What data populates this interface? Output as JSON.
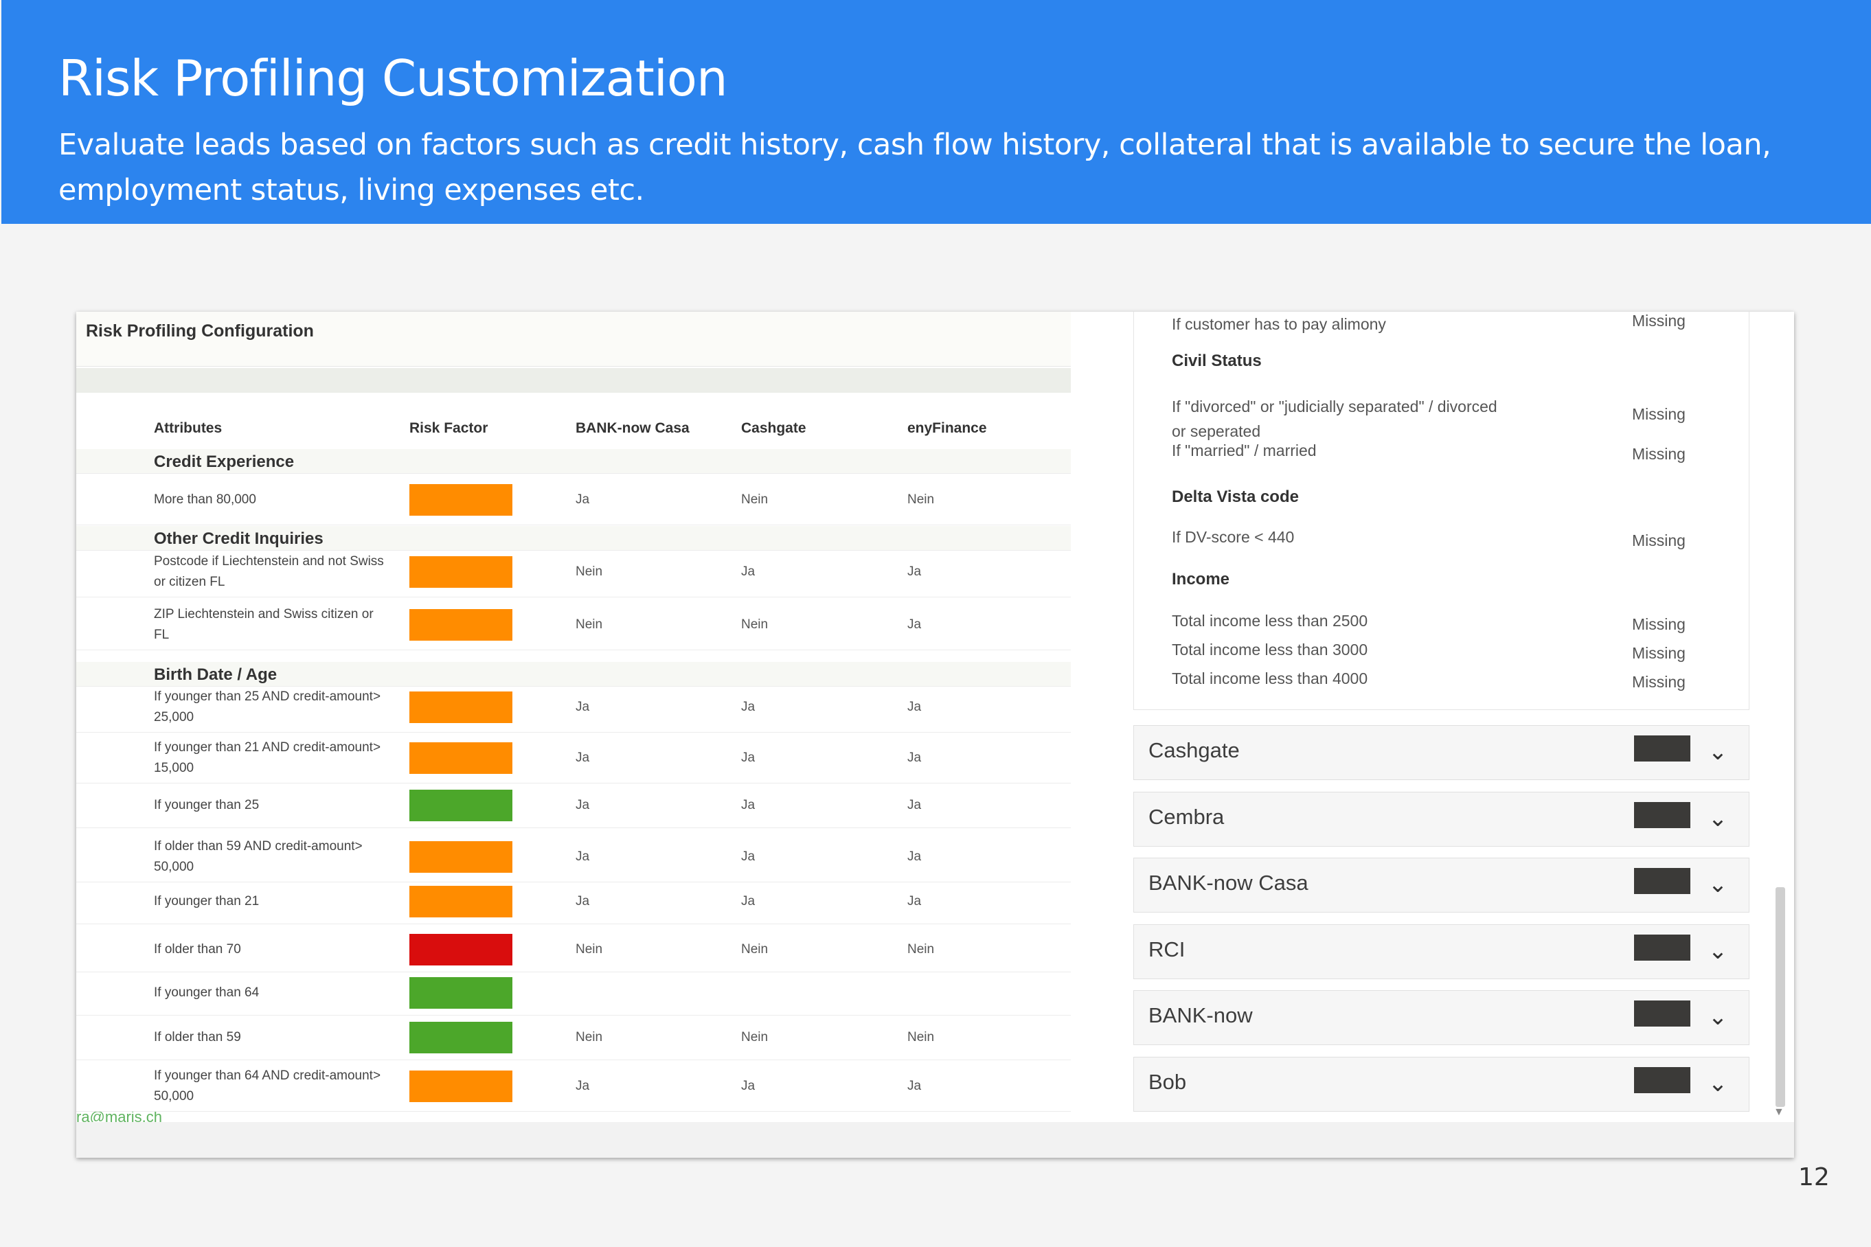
{
  "slide": {
    "title": "Risk Profiling Customization",
    "subtitle": "Evaluate leads based on factors such as credit history, cash flow history, collateral that is available to secure the loan, employment status, living expenses etc.",
    "page_number": "12"
  },
  "config": {
    "title": "Risk Profiling Configuration",
    "headers": [
      "Attributes",
      "Risk Factor",
      "BANK-now Casa",
      "Cashgate",
      "enyFinance"
    ],
    "footer_link": "ra@maris.ch",
    "sections": [
      {
        "label": "Credit Experience",
        "rows": [
          {
            "attr": "More than 80,000",
            "risk": "#ff8c00",
            "vals": [
              "Ja",
              "Nein",
              "Nein"
            ]
          }
        ]
      },
      {
        "label": "Other Credit Inquiries",
        "rows": [
          {
            "attr": "Postcode if Liechtenstein and not Swiss or citizen FL",
            "risk": "#ff8c00",
            "vals": [
              "Nein",
              "Ja",
              "Ja"
            ]
          },
          {
            "attr": "ZIP Liechtenstein and Swiss citizen or FL",
            "risk": "#ff8c00",
            "vals": [
              "Nein",
              "Nein",
              "Ja"
            ]
          }
        ]
      },
      {
        "label": "Birth Date / Age",
        "rows": [
          {
            "attr": "If younger than 25 AND credit-amount> 25,000",
            "risk": "#ff8c00",
            "vals": [
              "Ja",
              "Ja",
              "Ja"
            ]
          },
          {
            "attr": "If younger than 21 AND credit-amount> 15,000",
            "risk": "#ff8c00",
            "vals": [
              "Ja",
              "Ja",
              "Ja"
            ]
          },
          {
            "attr": "If younger than 25",
            "risk": "#4ca72a",
            "vals": [
              "Ja",
              "Ja",
              "Ja"
            ]
          },
          {
            "attr": "If older than 59 AND credit-amount> 50,000",
            "risk": "#ff8c00",
            "vals": [
              "Ja",
              "Ja",
              "Ja"
            ]
          },
          {
            "attr": "If younger than 21",
            "risk": "#ff8c00",
            "vals": [
              "Ja",
              "Ja",
              "Ja"
            ]
          },
          {
            "attr": "If older than 70",
            "risk": "#d90d0d",
            "vals": [
              "Nein",
              "Nein",
              "Nein"
            ]
          },
          {
            "attr": "If younger than 64",
            "risk": "#4ca72a",
            "vals": [
              "",
              "",
              ""
            ]
          },
          {
            "attr": "If older than 59",
            "risk": "#4ca72a",
            "vals": [
              "Nein",
              "Nein",
              "Nein"
            ]
          },
          {
            "attr": "If younger than 64 AND credit-amount> 50,000",
            "risk": "#ff8c00",
            "vals": [
              "Ja",
              "Ja",
              "Ja"
            ]
          }
        ]
      }
    ]
  },
  "details": {
    "top_item": {
      "label": "If customer has to pay alimony",
      "value": "Missing"
    },
    "sections": [
      {
        "label": "Civil Status",
        "items": [
          {
            "label": "If \"divorced\" or \"judicially separated\" / divorced or seperated",
            "value": "Missing"
          },
          {
            "label": "If \"married\" / married",
            "value": "Missing"
          }
        ]
      },
      {
        "label": "Delta Vista code",
        "items": [
          {
            "label": "If DV-score < 440",
            "value": "Missing"
          }
        ]
      },
      {
        "label": "Income",
        "items": [
          {
            "label": "Total income less than 2500",
            "value": "Missing"
          },
          {
            "label": "Total income less than 3000",
            "value": "Missing"
          },
          {
            "label": "Total income less than 4000",
            "value": "Missing"
          }
        ]
      }
    ]
  },
  "lenders": [
    {
      "name": "Cashgate",
      "color": "#3b3a38",
      "icon": "chevron-down-icon"
    },
    {
      "name": "Cembra",
      "color": "#3b3a38",
      "icon": "chevron-down-icon"
    },
    {
      "name": "BANK-now Casa",
      "color": "#3b3a38",
      "icon": "chevron-down-icon"
    },
    {
      "name": "RCI",
      "color": "#3b3a38",
      "icon": "chevron-down-icon"
    },
    {
      "name": "BANK-now",
      "color": "#3b3a38",
      "icon": "chevron-down-icon"
    },
    {
      "name": "Bob",
      "color": "#3b3a38",
      "icon": "chevron-down-icon"
    }
  ]
}
